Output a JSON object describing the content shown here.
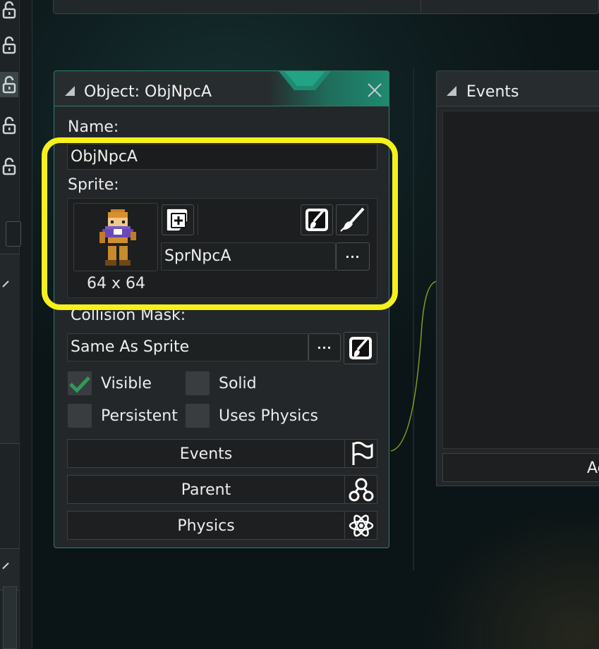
{
  "object_window": {
    "title": "Object: ObjNpcA",
    "name_label": "Name:",
    "name_value": "ObjNpcA",
    "sprite_label": "Sprite:",
    "sprite_name": "SprNpcA",
    "sprite_size": "64 x 64",
    "collision_label": "Collision Mask:",
    "collision_value": "Same As Sprite",
    "more_glyph": "···",
    "checkboxes": {
      "visible": {
        "label": "Visible",
        "checked": true
      },
      "solid": {
        "label": "Solid",
        "checked": false
      },
      "persistent": {
        "label": "Persistent",
        "checked": false
      },
      "uses_physics": {
        "label": "Uses Physics",
        "checked": false
      }
    },
    "buttons": {
      "events": {
        "label": "Events",
        "icon": "flag-icon"
      },
      "parent": {
        "label": "Parent",
        "icon": "hierarchy-icon"
      },
      "physics": {
        "label": "Physics",
        "icon": "atom-icon"
      }
    }
  },
  "events_window": {
    "title": "Events",
    "add_button_partial": "Ac"
  },
  "colors": {
    "highlight": "#f6f01b",
    "accent_teal": "#1f8a71",
    "check_green": "#2e9a5a",
    "connector": "#7d9a2a"
  }
}
